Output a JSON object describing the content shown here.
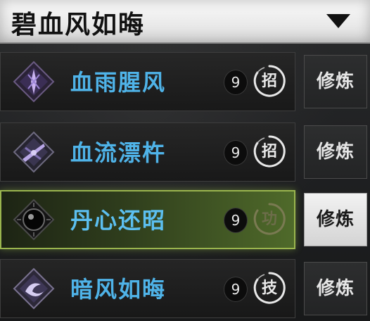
{
  "header": {
    "title": "碧血风如晦",
    "arrow_icon": "dropdown-triangle-icon"
  },
  "skills": [
    {
      "name": "血雨腥风",
      "ear_label": "9",
      "type_label": "招",
      "button_label": "修炼",
      "icon": "purple-crystal-diamond-icon",
      "active": false
    },
    {
      "name": "血流漂杵",
      "ear_label": "9",
      "type_label": "招",
      "button_label": "修炼",
      "icon": "purple-blade-diamond-icon",
      "active": false
    },
    {
      "name": "丹心还昭",
      "ear_label": "9",
      "type_label": "功",
      "button_label": "修炼",
      "icon": "black-orb-diamond-icon",
      "active": true
    },
    {
      "name": "暗风如晦",
      "ear_label": "9",
      "type_label": "技",
      "button_label": "修炼",
      "icon": "purple-swirl-diamond-icon",
      "active": false
    }
  ],
  "colors": {
    "skill_name": "#4fb3e8",
    "active_border": "#9ab54e",
    "active_bg": "#4f6a2a"
  }
}
